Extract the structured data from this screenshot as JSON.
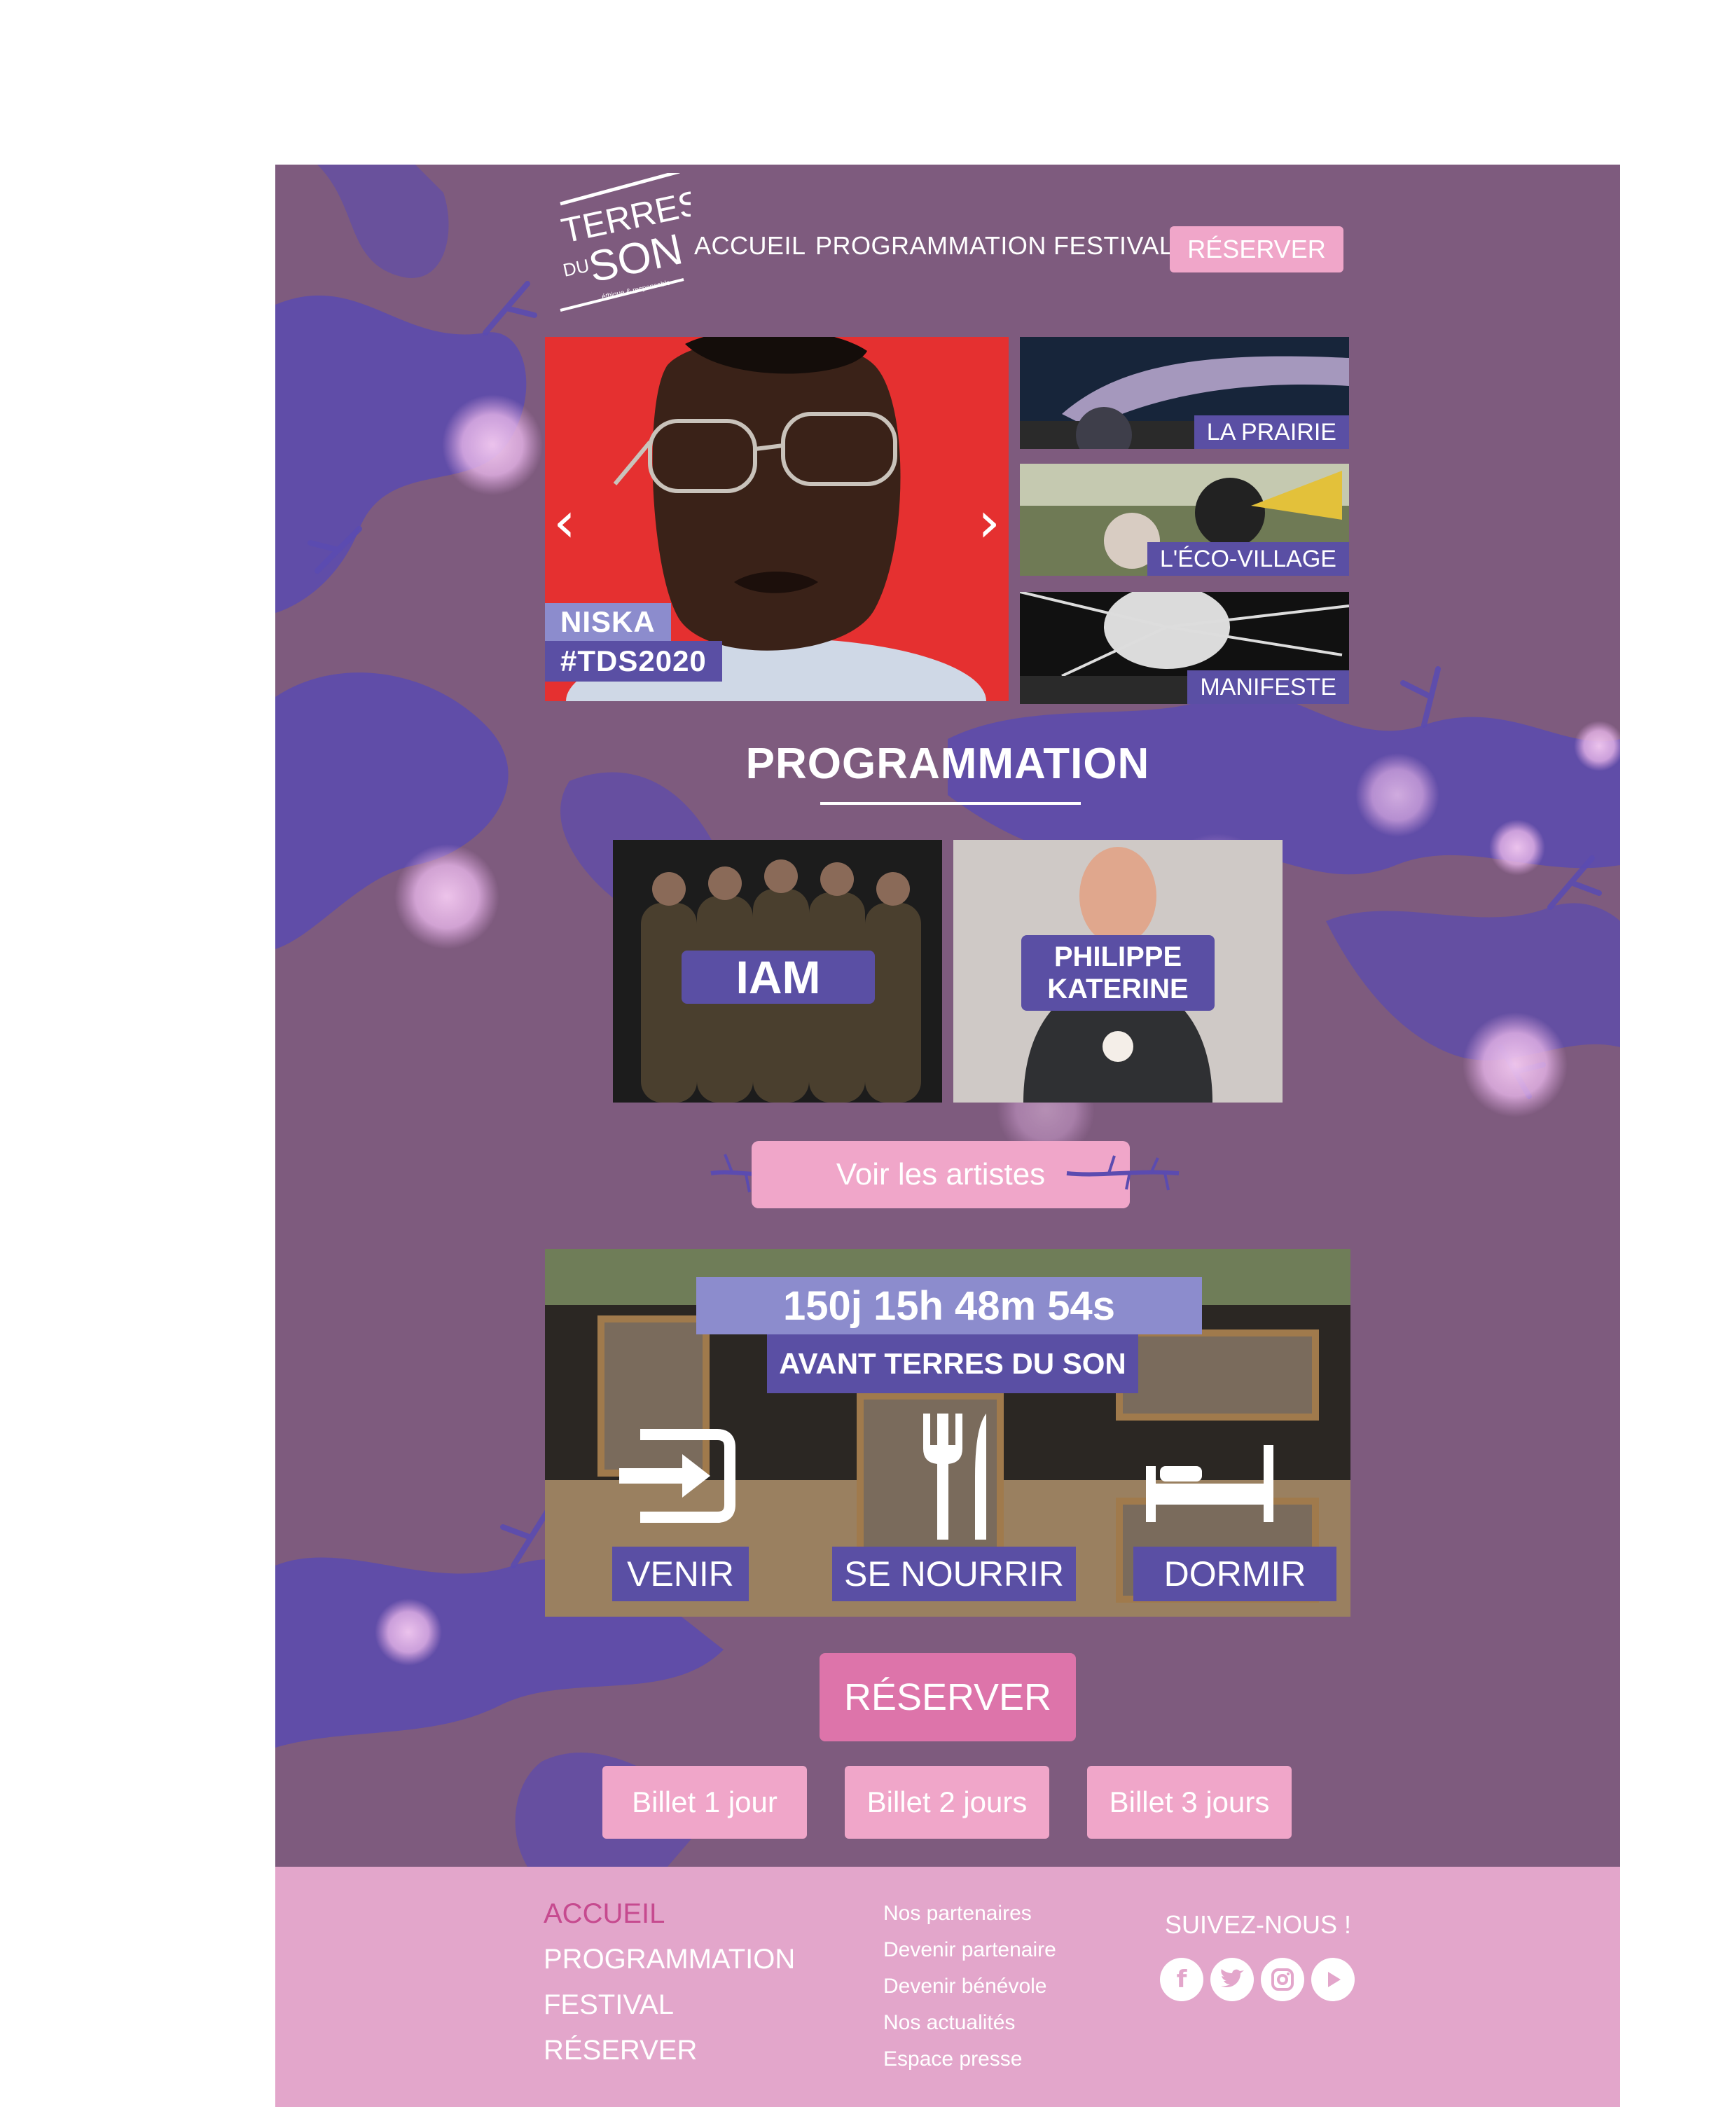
{
  "brand": {
    "logo_line1": "TERRES",
    "logo_line2": "DU",
    "logo_line3": "SON",
    "logo_tagline": "éthique & responsable"
  },
  "colors": {
    "background": "#7e5b7e",
    "accent_pink": "#f0a6c9",
    "accent_pink_dark": "#dd74aa",
    "label_purple": "#5a4fa4",
    "label_periwinkle": "#8c8ccd",
    "footer_pink": "#e3a6cb",
    "footer_active": "#c64a8f"
  },
  "nav": {
    "accueil": "ACCUEIL",
    "programmation": "PROGRAMMATION",
    "festival": "FESTIVAL",
    "reserver": "RÉSERVER"
  },
  "hero": {
    "artist": "NISKA",
    "hashtag": "#TDS2020",
    "prev_icon": "chevron-left-icon",
    "next_icon": "chevron-right-icon"
  },
  "thumbnails": [
    {
      "label": "LA PRAIRIE"
    },
    {
      "label": "L'ÉCO-VILLAGE"
    },
    {
      "label": "MANIFESTE"
    }
  ],
  "programmation": {
    "title": "PROGRAMMATION",
    "artists": [
      {
        "name": "IAM"
      },
      {
        "name_line1": "PHILIPPE",
        "name_line2": "KATERINE"
      }
    ],
    "cta": "Voir les artistes"
  },
  "countdown": {
    "value": "150j 15h 48m 54s",
    "subtitle": "AVANT TERRES DU SON",
    "actions": [
      {
        "label": "VENIR",
        "icon": "enter-icon"
      },
      {
        "label": "SE NOURRIR",
        "icon": "fork-knife-icon"
      },
      {
        "label": "DORMIR",
        "icon": "bed-icon"
      }
    ]
  },
  "reserve": {
    "main": "RÉSERVER",
    "tickets": [
      "Billet 1 jour",
      "Billet 2 jours",
      "Billet 3 jours"
    ]
  },
  "footer": {
    "nav": [
      "ACCUEIL",
      "PROGRAMMATION",
      "FESTIVAL",
      "RÉSERVER"
    ],
    "links": [
      "Nos partenaires",
      "Devenir partenaire",
      "Devenir bénévole",
      "Nos actualités",
      "Espace presse"
    ],
    "follow": "SUIVEZ-NOUS !",
    "social": [
      "facebook-icon",
      "twitter-icon",
      "instagram-icon",
      "youtube-icon"
    ]
  }
}
